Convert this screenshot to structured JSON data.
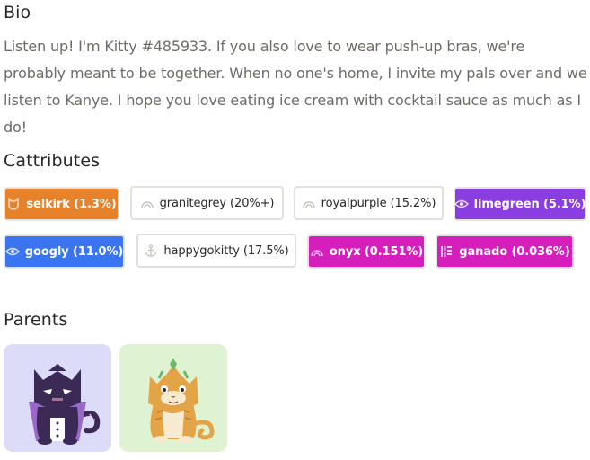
{
  "bio": {
    "title": "Bio",
    "text": "Listen up! I'm Kitty #485933. If you also love to wear push-up bras, we're probably meant to be together. When no one's home, I invite my pals over and we listen to Kanye. I hope you love eating ice cream with cocktail sauce as much as I do!"
  },
  "cattributes": {
    "title": "Cattributes",
    "items": [
      {
        "label": "selkirk (1.3%)",
        "icon": "cat-face-icon",
        "color": "#e8822a",
        "style": "solid"
      },
      {
        "label": "granitegrey (20%+)",
        "icon": "rainbow-icon",
        "style": "light"
      },
      {
        "label": "royalpurple (15.2%)",
        "icon": "rainbow-icon",
        "style": "light"
      },
      {
        "label": "limegreen (5.1%)",
        "icon": "eye-icon",
        "color": "#8a3de0",
        "style": "solid"
      },
      {
        "label": "googly (11.0%)",
        "icon": "eye-icon",
        "color": "#3a74f1",
        "style": "solid"
      },
      {
        "label": "happygokitty (17.5%)",
        "icon": "anchor-icon",
        "style": "light"
      },
      {
        "label": "onyx (0.151%)",
        "icon": "rainbow-icon",
        "color": "#d61ebd",
        "style": "solid"
      },
      {
        "label": "ganado (0.036%)",
        "icon": "pattern-icon",
        "color": "#d61ebd",
        "style": "solid"
      }
    ]
  },
  "parents": {
    "title": "Parents",
    "items": [
      {
        "background": "#dcdbf8",
        "kitty_color": "#3a2a55"
      },
      {
        "background": "#dff3d2",
        "kitty_color": "#e3a447"
      }
    ]
  }
}
